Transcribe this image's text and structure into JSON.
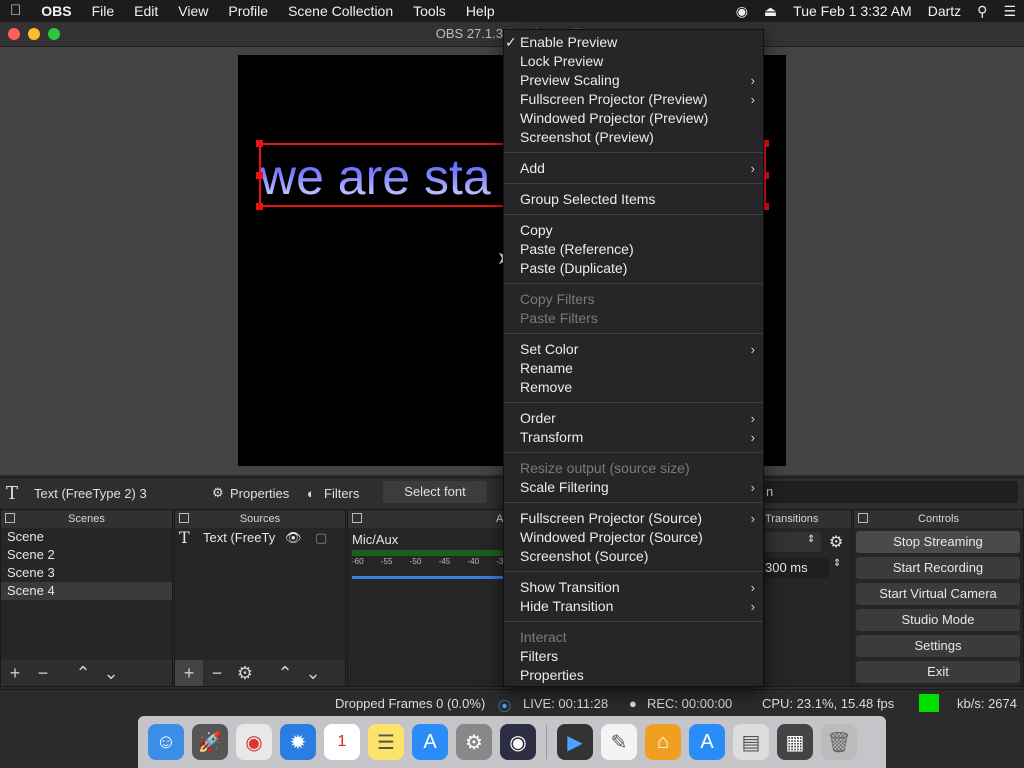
{
  "menubar": {
    "items": [
      "OBS",
      "File",
      "Edit",
      "View",
      "Profile",
      "Scene Collection",
      "Tools",
      "Help"
    ],
    "datetime": "Tue Feb 1  3:32 AM",
    "user": "Dartz"
  },
  "window": {
    "title": "OBS 27.1.3 (mac) - Profile"
  },
  "preview": {
    "text": "we are sta"
  },
  "source_toolbar": {
    "source_name": "Text (FreeType 2) 3",
    "properties": "Properties",
    "filters": "Filters",
    "select_font": "Select font",
    "filter_tail": "n"
  },
  "docks": {
    "scenes": {
      "title": "Scenes",
      "items": [
        "Scene",
        "Scene 2",
        "Scene 3",
        "Scene 4"
      ]
    },
    "sources": {
      "title": "Sources",
      "item": "Text (FreeTy"
    },
    "mixer": {
      "title": "A",
      "channel": "Mic/Aux",
      "ticks": [
        "-60",
        "-55",
        "-50",
        "-45",
        "-40",
        "-35"
      ]
    },
    "transitions": {
      "title": "Transitions",
      "duration": "300 ms"
    },
    "controls": {
      "title": "Controls",
      "buttons": [
        "Stop Streaming",
        "Start Recording",
        "Start Virtual Camera",
        "Studio Mode",
        "Settings",
        "Exit"
      ]
    }
  },
  "status": {
    "dropped": "Dropped Frames 0 (0.0%)",
    "live": "LIVE: 00:11:28",
    "rec": "REC: 00:00:00",
    "cpu": "CPU: 23.1%, 15.48 fps",
    "kbs": "kb/s: 2674",
    "indicator_color": "#00e000"
  },
  "context_menu": {
    "items": [
      {
        "label": "Enable Preview",
        "checked": true
      },
      {
        "label": "Lock Preview"
      },
      {
        "label": "Preview Scaling",
        "submenu": true
      },
      {
        "label": "Fullscreen Projector (Preview)",
        "submenu": true
      },
      {
        "label": "Windowed Projector (Preview)"
      },
      {
        "label": "Screenshot (Preview)"
      },
      {
        "label": "Add",
        "submenu": true
      },
      {
        "label": "Group Selected Items"
      },
      {
        "label": "Copy"
      },
      {
        "label": "Paste (Reference)"
      },
      {
        "label": "Paste (Duplicate)"
      },
      {
        "label": "Copy Filters",
        "disabled": true
      },
      {
        "label": "Paste Filters",
        "disabled": true
      },
      {
        "label": "Set Color",
        "submenu": true
      },
      {
        "label": "Rename"
      },
      {
        "label": "Remove"
      },
      {
        "label": "Order",
        "submenu": true
      },
      {
        "label": "Transform",
        "submenu": true
      },
      {
        "label": "Resize output (source size)",
        "disabled": true
      },
      {
        "label": "Scale Filtering",
        "submenu": true
      },
      {
        "label": "Fullscreen Projector (Source)",
        "submenu": true
      },
      {
        "label": "Windowed Projector (Source)"
      },
      {
        "label": "Screenshot (Source)"
      },
      {
        "label": "Show Transition",
        "submenu": true
      },
      {
        "label": "Hide Transition",
        "submenu": true
      },
      {
        "label": "Interact",
        "disabled": true
      },
      {
        "label": "Filters"
      },
      {
        "label": "Properties"
      }
    ]
  }
}
